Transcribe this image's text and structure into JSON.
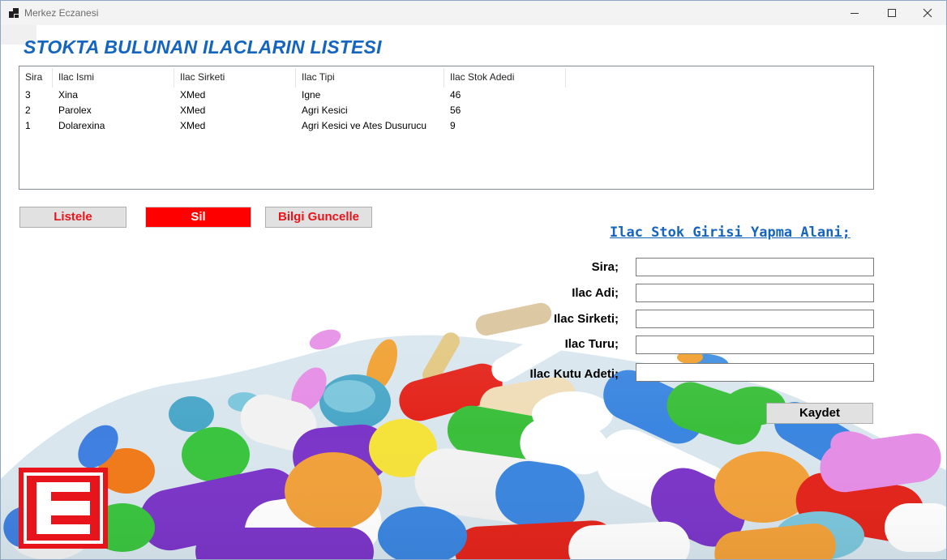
{
  "window": {
    "title": "Merkez Eczanesi"
  },
  "page": {
    "title": "STOKTA BULUNAN ILACLARIN LISTESI"
  },
  "list": {
    "columns": [
      "Sira",
      "Ilac Ismi",
      "Ilac Sirketi",
      "Ilac Tipi",
      "Ilac Stok Adedi"
    ],
    "rows": [
      [
        "3",
        "Xina",
        "XMed",
        "Igne",
        "46"
      ],
      [
        "2",
        "Parolex",
        "XMed",
        "Agri Kesici",
        "56"
      ],
      [
        "1",
        "Dolarexina",
        "XMed",
        "Agri Kesici ve Ates Dusurucu",
        "9"
      ]
    ]
  },
  "buttons": {
    "list": "Listele",
    "delete": "Sil",
    "update": "Bilgi Guncelle",
    "save": "Kaydet"
  },
  "form": {
    "title": "Ilac Stok Girisi Yapma Alani;",
    "fields": {
      "sira": {
        "label": "Sira;",
        "value": ""
      },
      "name": {
        "label": "Ilac Adi;",
        "value": ""
      },
      "company": {
        "label": "Ilac Sirketi;",
        "value": ""
      },
      "type": {
        "label": "Ilac Turu;",
        "value": ""
      },
      "count": {
        "label": "Ilac Kutu Adeti;",
        "value": ""
      }
    }
  },
  "colors": {
    "accent": "#1565c0",
    "danger": "#ff0000",
    "brand": "#e8141b"
  },
  "icons": [
    "app-icon",
    "minimize-icon",
    "maximize-icon",
    "close-icon",
    "pharmacy-e-logo"
  ]
}
